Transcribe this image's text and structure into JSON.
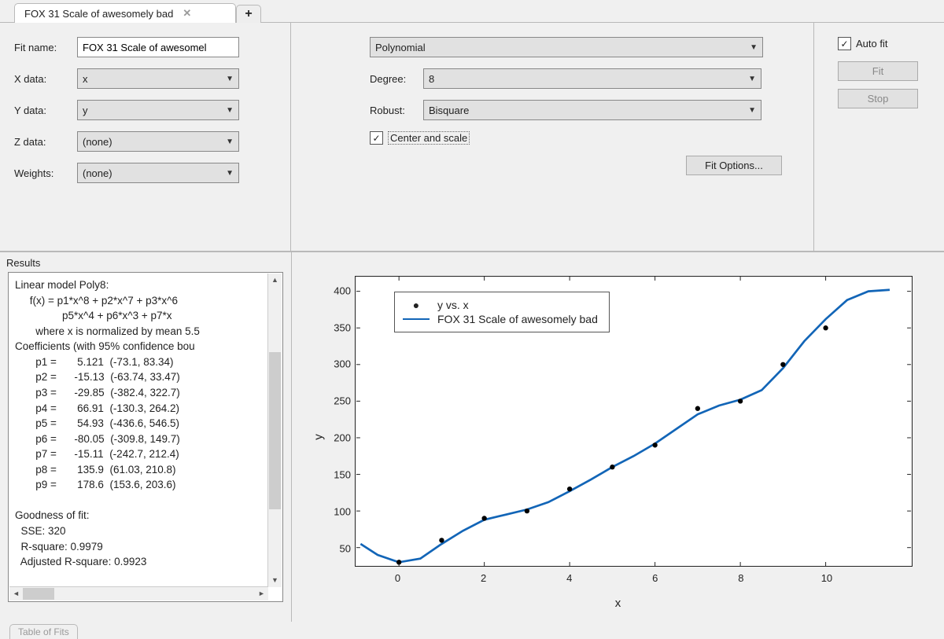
{
  "tab": {
    "title": "FOX 31 Scale of awesomely bad"
  },
  "left": {
    "fitname_label": "Fit name:",
    "fitname_value": "FOX 31 Scale of awesomel",
    "xdata_label": "X data:",
    "xdata_value": "x",
    "ydata_label": "Y data:",
    "ydata_value": "y",
    "zdata_label": "Z data:",
    "zdata_value": "(none)",
    "weights_label": "Weights:",
    "weights_value": "(none)"
  },
  "mid": {
    "fit_type": "Polynomial",
    "degree_label": "Degree:",
    "degree_value": "8",
    "robust_label": "Robust:",
    "robust_value": "Bisquare",
    "center_scale_label": "Center and scale",
    "center_scale_checked": "✓",
    "fit_options_label": "Fit Options..."
  },
  "right": {
    "autofit_label": "Auto fit",
    "autofit_checked": "✓",
    "fit_btn": "Fit",
    "stop_btn": "Stop"
  },
  "results": {
    "title": "Results",
    "text": "Linear model Poly8:\n     f(x) = p1*x^8 + p2*x^7 + p3*x^6\n                p5*x^4 + p6*x^3 + p7*x\n       where x is normalized by mean 5.5\nCoefficients (with 95% confidence bou\n       p1 =       5.121  (-73.1, 83.34)\n       p2 =      -15.13  (-63.74, 33.47)\n       p3 =      -29.85  (-382.4, 322.7)\n       p4 =       66.91  (-130.3, 264.2)\n       p5 =       54.93  (-436.6, 546.5)\n       p6 =      -80.05  (-309.8, 149.7)\n       p7 =      -15.11  (-242.7, 212.4)\n       p8 =       135.9  (61.03, 210.8)\n       p9 =       178.6  (153.6, 203.6)\n\nGoodness of fit:\n  SSE: 320\n  R-square: 0.9979\n  Adjusted R-square: 0.9923"
  },
  "legend": {
    "scatter": "y vs. x",
    "fit": "FOX 31 Scale of awesomely bad"
  },
  "axis": {
    "xlabel": "x",
    "ylabel": "y"
  },
  "chart_data": {
    "type": "scatter+line",
    "xlabel": "x",
    "ylabel": "y",
    "xlim": [
      -1,
      12
    ],
    "ylim": [
      25,
      420
    ],
    "xticks": [
      0,
      2,
      4,
      6,
      8,
      10
    ],
    "yticks": [
      50,
      100,
      150,
      200,
      250,
      300,
      350,
      400
    ],
    "scatter": {
      "name": "y vs. x",
      "x": [
        0,
        1,
        2,
        3,
        4,
        5,
        6,
        7,
        8,
        9,
        10
      ],
      "y": [
        30,
        60,
        90,
        100,
        130,
        160,
        190,
        240,
        250,
        300,
        350
      ]
    },
    "fit_line": {
      "name": "FOX 31 Scale of awesomely bad",
      "x": [
        -0.9,
        -0.5,
        0,
        0.5,
        1,
        1.5,
        2,
        2.5,
        3,
        3.5,
        4,
        4.5,
        5,
        5.5,
        6,
        6.5,
        7,
        7.5,
        8,
        8.5,
        9,
        9.5,
        10,
        10.5,
        11,
        11.5
      ],
      "y": [
        55,
        40,
        30,
        35,
        55,
        73,
        88,
        95,
        102,
        112,
        127,
        143,
        160,
        175,
        192,
        212,
        232,
        244,
        252,
        265,
        295,
        332,
        362,
        388,
        400,
        402
      ]
    }
  },
  "bottom_tab": "Table of Fits"
}
